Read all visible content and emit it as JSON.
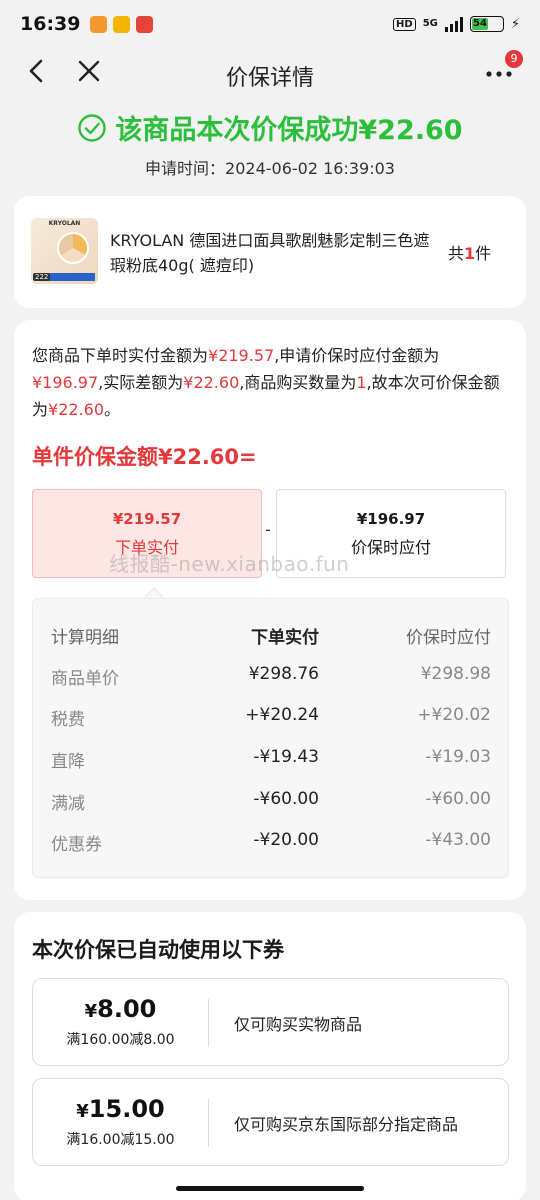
{
  "status": {
    "time": "16:39",
    "hd": "HD",
    "network": "5G",
    "battery": "54",
    "battery_percent": 54,
    "app_icons": [
      "app-notification-icon-1",
      "app-notification-icon-2",
      "app-notification-icon-3"
    ]
  },
  "nav": {
    "title": "价保详情",
    "badge_count": "9"
  },
  "result": {
    "message": "该商品本次价保成功¥22.60",
    "apply_time": "申请时间：2024-06-02 16:39:03",
    "accent_color": "#2cbf3c"
  },
  "product": {
    "thumb_brand": "KRYOLAN",
    "thumb_price": "222",
    "name": "KRYOLAN 德国进口面具歌剧魅影定制三色遮瑕粉底40g( 遮痘印)",
    "qty_prefix": "共",
    "qty": "1",
    "qty_suffix": "件"
  },
  "explanation": {
    "p1": "您商品下单时实付金额为",
    "paid": "¥219.57",
    "p2": ",申请价保时应付金额为",
    "protected": "¥196.97",
    "p3": ",实际差额为",
    "diff": "¥22.60",
    "p4": ",商品购买数量为",
    "qty": "1",
    "p5": ",故本次可价保金额为",
    "refund": "¥22.60",
    "p6": "。",
    "unit_title": "单件价保金额¥22.60="
  },
  "compare": {
    "left_amount": "¥219.57",
    "left_label": "下单实付",
    "operator": "-",
    "right_amount": "¥196.97",
    "right_label": "价保时应付"
  },
  "calc_table": {
    "headers": [
      "计算明细",
      "下单实付",
      "价保时应付"
    ],
    "rows": [
      {
        "label": "商品单价",
        "paid": "¥298.76",
        "protect": "¥298.98"
      },
      {
        "label": "税费",
        "paid": "+¥20.24",
        "protect": "+¥20.02"
      },
      {
        "label": "直降",
        "paid": "-¥19.43",
        "protect": "-¥19.03"
      },
      {
        "label": "满减",
        "paid": "-¥60.00",
        "protect": "-¥60.00"
      },
      {
        "label": "优惠券",
        "paid": "-¥20.00",
        "protect": "-¥43.00"
      }
    ]
  },
  "watermark": "线报酷-new.xianbao.fun",
  "coupons": {
    "title": "本次价保已自动使用以下券",
    "items": [
      {
        "yen": "¥",
        "amount": "8.00",
        "condition": "满160.00减8.00",
        "desc": "仅可购买实物商品"
      },
      {
        "yen": "¥",
        "amount": "15.00",
        "condition": "满16.00减15.00",
        "desc": "仅可购买京东国际部分指定商品"
      }
    ]
  },
  "colors": {
    "red": "#e4393c",
    "green": "#2cbf3c"
  }
}
